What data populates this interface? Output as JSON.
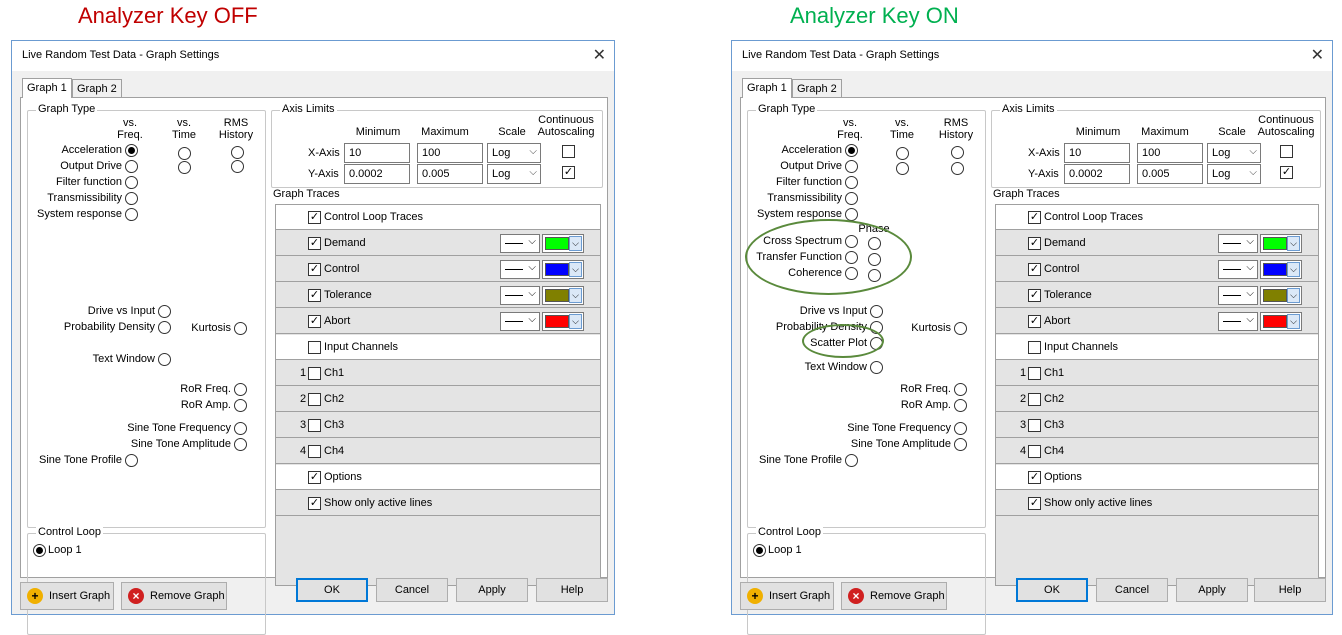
{
  "headings": {
    "left": "Analyzer Key OFF",
    "right": "Analyzer Key ON",
    "left_color": "#c00000",
    "right_color": "#00b050"
  },
  "dialog": {
    "title": "Live Random Test Data - Graph Settings",
    "close_icon": "close-icon",
    "tabs": [
      "Graph 1",
      "Graph 2"
    ],
    "graph_type": {
      "label": "Graph Type",
      "col_headers": {
        "freq": "vs.\nFreq.",
        "time": "vs.\nTime",
        "rms": "RMS\nHistory",
        "phase": "Phase"
      },
      "rows": {
        "acceleration": "Acceleration",
        "output_drive": "Output Drive",
        "filter_function": "Filter function",
        "transmissibility": "Transmissibility",
        "system_response": "System response",
        "cross_spectrum": "Cross Spectrum",
        "transfer_function": "Transfer Function",
        "coherence": "Coherence",
        "drive_vs_input": "Drive vs Input",
        "probability_density": "Probability Density",
        "kurtosis": "Kurtosis",
        "scatter_plot": "Scatter Plot",
        "text_window": "Text Window",
        "ror_freq": "RoR Freq.",
        "ror_amp": "RoR Amp.",
        "sine_tone_frequency": "Sine Tone Frequency",
        "sine_tone_amplitude": "Sine Tone Amplitude",
        "sine_tone_profile": "Sine Tone Profile"
      }
    },
    "control_loop": {
      "label": "Control Loop",
      "option": "Loop 1"
    },
    "axis_limits": {
      "label": "Axis Limits",
      "headers": {
        "minimum": "Minimum",
        "maximum": "Maximum",
        "scale": "Scale",
        "autoscale": "Continuous\nAutoscaling"
      },
      "x": {
        "label": "X-Axis",
        "min": "10",
        "max": "100",
        "scale": "Log",
        "autoscale": false
      },
      "y": {
        "label": "Y-Axis",
        "min": "0.0002",
        "max": "0.005",
        "scale": "Log",
        "autoscale": true
      }
    },
    "graph_traces": {
      "label": "Graph Traces",
      "control_loop_traces": "Control Loop Traces",
      "demand": "Demand",
      "control": "Control",
      "tolerance": "Tolerance",
      "abort": "Abort",
      "input_channels": "Input Channels",
      "ch1": "Ch1",
      "ch2": "Ch2",
      "ch3": "Ch3",
      "ch4": "Ch4",
      "n1": "1",
      "n2": "2",
      "n3": "3",
      "n4": "4",
      "options": "Options",
      "show_only_active": "Show only active lines",
      "colors": {
        "demand": "#00ff00",
        "control": "#0000ff",
        "tolerance": "#808000",
        "abort": "#ff0000"
      }
    },
    "buttons": {
      "insert_graph": "Insert Graph",
      "remove_graph": "Remove Graph",
      "ok": "OK",
      "cancel": "Cancel",
      "apply": "Apply",
      "help": "Help"
    },
    "check_mark": "✓"
  }
}
